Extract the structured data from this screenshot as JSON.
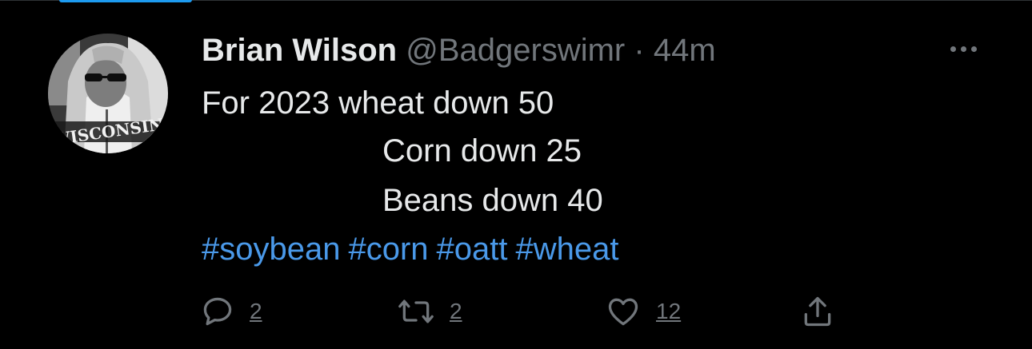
{
  "tweet": {
    "author_name": "Brian Wilson",
    "handle": "@Badgerswimr",
    "separator": "·",
    "time": "44m",
    "lines": [
      "For 2023 wheat down 50",
      "Corn down 25",
      "Beans down 40"
    ],
    "hashtags": [
      "#soybean",
      "#corn",
      "#oatt",
      "#wheat"
    ],
    "avatar_text": "WISCONSIN"
  },
  "actions": {
    "reply": {
      "icon": "reply-icon",
      "count": "2"
    },
    "retweet": {
      "icon": "retweet-icon",
      "count": "2"
    },
    "like": {
      "icon": "heart-icon",
      "count": "12"
    },
    "share": {
      "icon": "share-icon"
    }
  },
  "colors": {
    "background": "#000000",
    "text": "#e7e9ea",
    "muted": "#71767b",
    "link": "#4a99e9",
    "accent": "#1d9bf0"
  }
}
